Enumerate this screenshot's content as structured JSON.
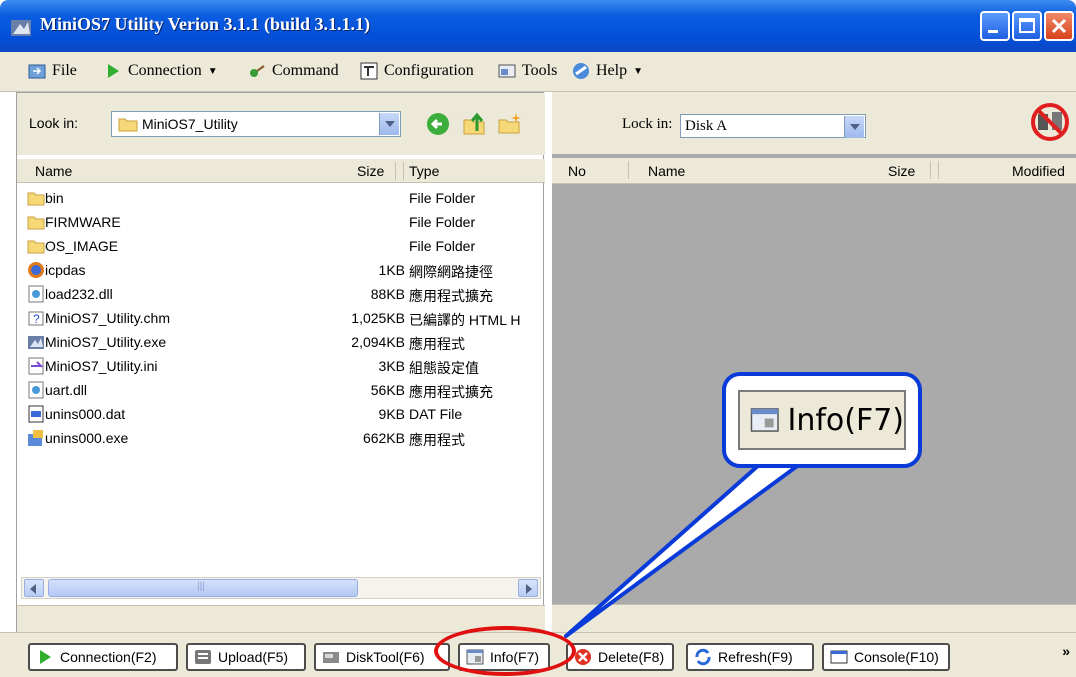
{
  "window": {
    "title": "MiniOS7 Utility Verion 3.1.1 (build 3.1.1.1)"
  },
  "menu": {
    "file": "File",
    "connection": "Connection",
    "command": "Command",
    "configuration": "Configuration",
    "tools": "Tools",
    "help": "Help"
  },
  "left_pane": {
    "look_in_label": "Look in:",
    "look_in_value": "MiniOS7_Utility",
    "headers": {
      "name": "Name",
      "size": "Size",
      "type": "Type"
    },
    "files": [
      {
        "name": "bin",
        "size": "",
        "type": "File Folder",
        "icon": "folder-icon"
      },
      {
        "name": "FIRMWARE",
        "size": "",
        "type": "File Folder",
        "icon": "folder-icon"
      },
      {
        "name": "OS_IMAGE",
        "size": "",
        "type": "File Folder",
        "icon": "folder-icon"
      },
      {
        "name": "icpdas",
        "size": "1KB",
        "type": "網際網路捷徑",
        "icon": "internet-shortcut-icon"
      },
      {
        "name": "load232.dll",
        "size": "88KB",
        "type": "應用程式擴充",
        "icon": "dll-icon"
      },
      {
        "name": "MiniOS7_Utility.chm",
        "size": "1,025KB",
        "type": "已編譯的 HTML H",
        "icon": "help-file-icon"
      },
      {
        "name": "MiniOS7_Utility.exe",
        "size": "2,094KB",
        "type": "應用程式",
        "icon": "app-icon"
      },
      {
        "name": "MiniOS7_Utility.ini",
        "size": "3KB",
        "type": "組態設定值",
        "icon": "ini-icon"
      },
      {
        "name": "uart.dll",
        "size": "56KB",
        "type": "應用程式擴充",
        "icon": "dll-icon"
      },
      {
        "name": "unins000.dat",
        "size": "9KB",
        "type": "DAT File",
        "icon": "dat-icon"
      },
      {
        "name": "unins000.exe",
        "size": "662KB",
        "type": "應用程式",
        "icon": "installer-icon"
      }
    ]
  },
  "right_pane": {
    "look_in_label": "Lock in:",
    "look_in_value": "Disk A",
    "headers": {
      "no": "No",
      "name": "Name",
      "size": "Size",
      "modified": "Modified"
    }
  },
  "toolbar": {
    "connection": "Connection(F2)",
    "upload": "Upload(F5)",
    "disktool": "DiskTool(F6)",
    "info": "Info(F7)",
    "delete": "Delete(F8)",
    "refresh": "Refresh(F9)",
    "console": "Console(F10)",
    "more": "»"
  },
  "callout": {
    "label": "Info(F7)"
  },
  "colors": {
    "titlebar": "#0450d8",
    "callout_border": "#0a3bd8",
    "highlight_ellipse": "#e01010",
    "panel_bg": "#ece9d8",
    "remote_list_bg": "#aaaaaa"
  }
}
